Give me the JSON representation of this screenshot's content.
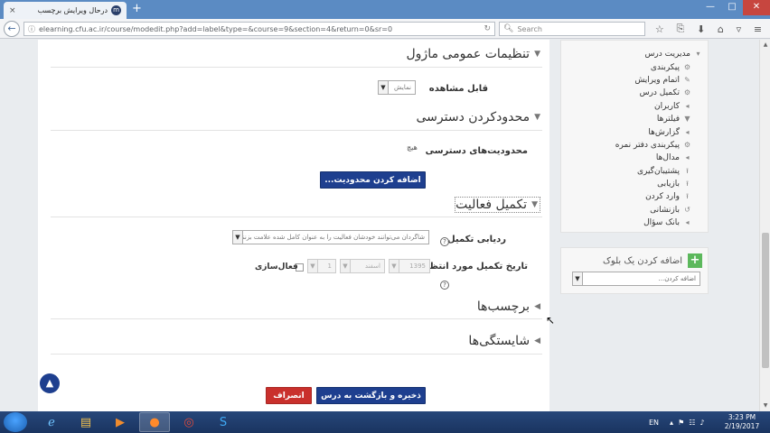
{
  "browser": {
    "tab_title": "درحال ویرایش برچسب",
    "tab_favicon": "m",
    "tab_close": "×",
    "new_tab": "+",
    "url": "elearning.cfu.ac.ir/course/modedit.php?add=label&type=&course=9&section=4&return=0&sr=0",
    "search_placeholder": "Search",
    "icons": [
      "star-icon",
      "clipboard-icon",
      "download-icon",
      "home-icon",
      "pocket-icon",
      "menu-icon"
    ]
  },
  "sections": {
    "general_title": "تنظیمات عمومی ماژول",
    "restrict_title": "محدودکردن دسترسی",
    "completion_title": "تکمیل فعالیت",
    "tags_title": "برچسب‌ها",
    "competencies_title": "شایستگی‌ها"
  },
  "fields": {
    "visible_label": "قابل مشاهده",
    "visible_value": "نمایش",
    "restrictions_label": "محدودیت‌های دسترسی",
    "restrictions_value": "هیچ",
    "add_restriction_button": "اضافه کردن محدودیت...",
    "completion_tracking_label": "ردیابی تکمیل",
    "completion_tracking_value": "شاگردان می‌توانند خودشان فعالیت را به عنوان کامل شده علامت بزنند",
    "expected_completion_label": "تاریخ تکمیل مورد انتظار",
    "date_day": "1",
    "date_month": "اسفند",
    "date_year": "1395",
    "enable_label": "فعال‌سازی"
  },
  "buttons": {
    "save_return": "ذخیره و بازگشت به درس",
    "cancel": "انصراف"
  },
  "sidebar": {
    "admin_items": [
      {
        "label": "مدیریت درس",
        "icon": "caret-down-icon",
        "indent": 0
      },
      {
        "label": "پیکربندی",
        "icon": "gear-icon",
        "indent": 1
      },
      {
        "label": "اتمام ویرایش",
        "icon": "pencil-icon",
        "indent": 1
      },
      {
        "label": "تکمیل درس",
        "icon": "gear-icon",
        "indent": 1
      },
      {
        "label": "کاربران",
        "icon": "caret-left-icon",
        "indent": 1
      },
      {
        "label": "فیلترها",
        "icon": "filter-icon",
        "indent": 1
      },
      {
        "label": "گزارش‌ها",
        "icon": "caret-left-icon",
        "indent": 1
      },
      {
        "label": "پیکربندی دفتر نمره",
        "icon": "gear-icon",
        "indent": 1
      },
      {
        "label": "مدال‌ها",
        "icon": "caret-left-icon",
        "indent": 1
      },
      {
        "label": "پشتیبان‌گیری",
        "icon": "upload-icon",
        "indent": 1
      },
      {
        "label": "بازیابی",
        "icon": "upload-icon",
        "indent": 1
      },
      {
        "label": "وارد کردن",
        "icon": "upload-icon",
        "indent": 1
      },
      {
        "label": "بازنشانی",
        "icon": "reset-icon",
        "indent": 1
      },
      {
        "label": "بانک سؤال",
        "icon": "caret-left-icon",
        "indent": 1
      }
    ],
    "add_block_title": "اضافه کردن یک بلوک",
    "add_block_placeholder": "اضافه کردن..."
  },
  "taskbar": {
    "apps": [
      "ie-icon",
      "folder-icon",
      "media-player-icon",
      "firefox-icon",
      "chrome-icon",
      "skype-icon"
    ],
    "lang": "EN",
    "time": "3:23 PM",
    "date": "2/19/2017"
  }
}
